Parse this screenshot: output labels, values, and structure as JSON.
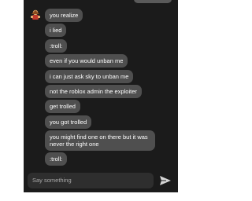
{
  "chat": {
    "messages": [
      {
        "text": "you realize"
      },
      {
        "text": "i lied"
      },
      {
        "text": ":troll:"
      },
      {
        "text": "even if you would unban me"
      },
      {
        "text": "i can just ask sky to unban me"
      },
      {
        "text": "not the roblox admin the exploiter"
      },
      {
        "text": "get trolled"
      },
      {
        "text": "you got trolled"
      },
      {
        "text": "you might find one on there but it was never the right one"
      },
      {
        "text": ":troll:"
      }
    ]
  },
  "composer": {
    "placeholder": "Say something",
    "send_icon": "send-icon"
  },
  "colors": {
    "panel_background": "#1b1b1b",
    "bubble": "#4f4f4f",
    "input_background": "#2e2e2e",
    "text": "#ffffff",
    "placeholder_text": "#a9a9a9"
  }
}
